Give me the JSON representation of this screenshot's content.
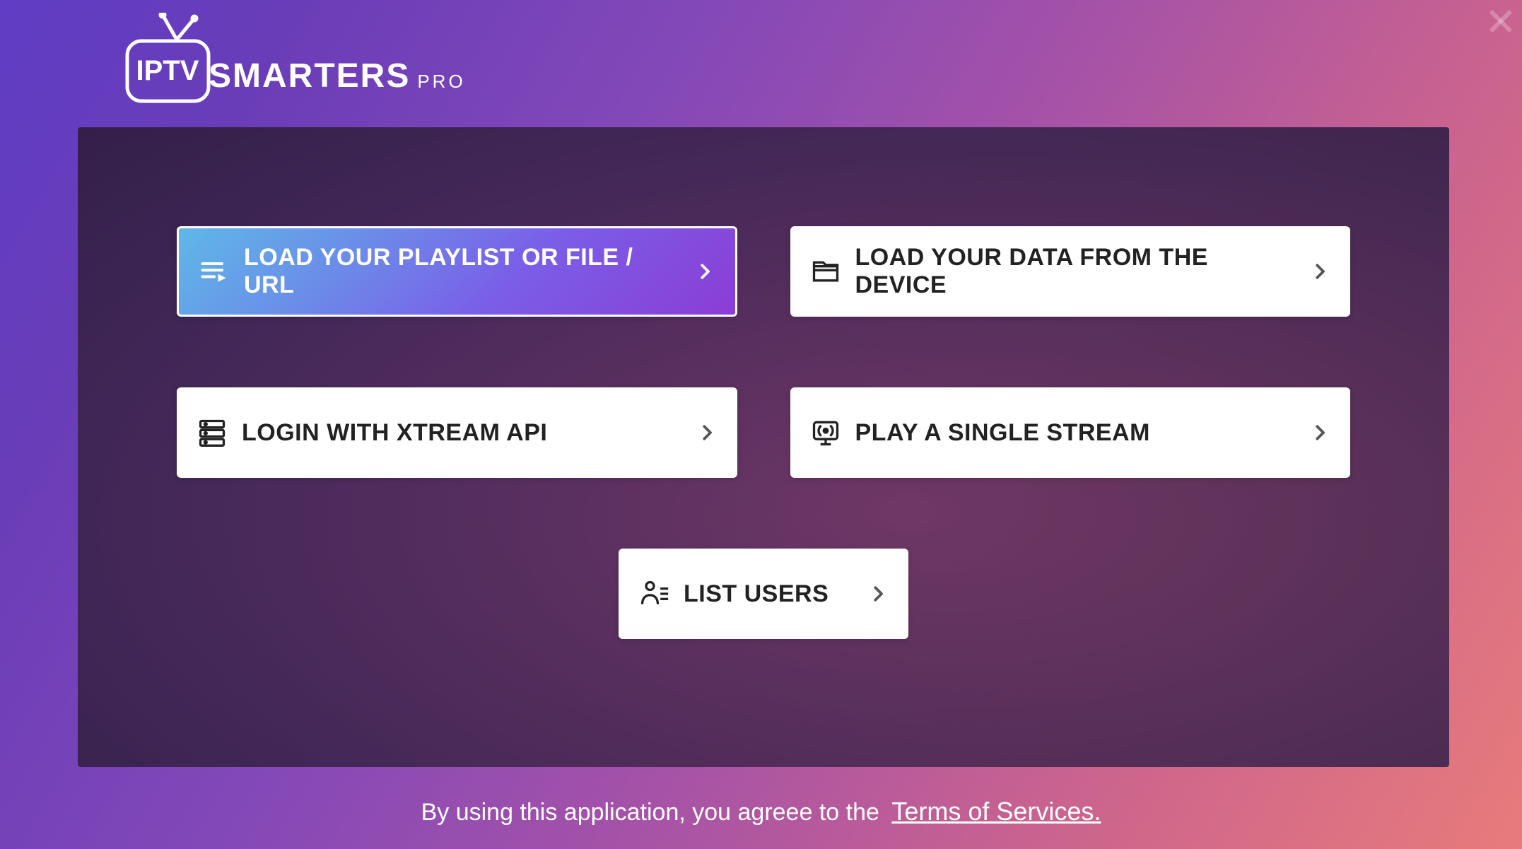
{
  "logo": {
    "tv_text": "IPTV",
    "main_text": "SMARTERS",
    "pro_text": "PRO"
  },
  "options": {
    "playlist": {
      "label": "LOAD YOUR PLAYLIST OR FILE / URL"
    },
    "device": {
      "label": "LOAD YOUR DATA FROM THE DEVICE"
    },
    "xtream": {
      "label": "LOGIN WITH XTREAM API"
    },
    "stream": {
      "label": "PLAY A SINGLE STREAM"
    },
    "users": {
      "label": "LIST USERS"
    }
  },
  "footer": {
    "text": "By using this application, you agreee to the",
    "terms": "Terms of Services."
  }
}
